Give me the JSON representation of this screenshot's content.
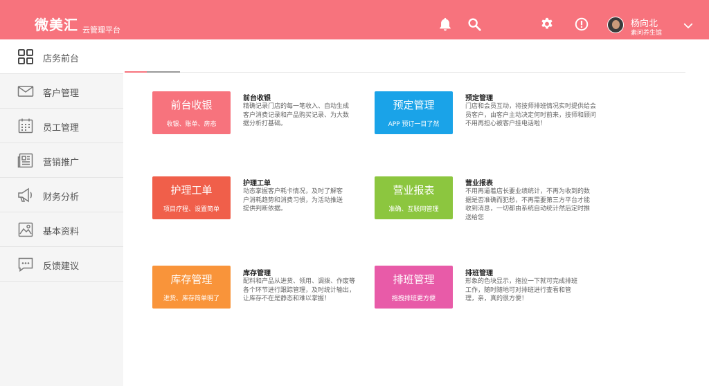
{
  "header": {
    "logo": "微美汇",
    "logo_sub": "云管理平台",
    "user_name": "杨向北",
    "user_store": "素问养生馆",
    "bg_color": "#f7737d",
    "icons": [
      "bell-icon",
      "search-icon",
      "gear-icon",
      "alert-icon",
      "chevron-down-icon"
    ]
  },
  "sidebar": {
    "top": {
      "label": "店务前台",
      "icon": "grid-icon"
    },
    "items": [
      {
        "label": "客户管理",
        "icon": "mail-icon"
      },
      {
        "label": "员工管理",
        "icon": "calendar-icon"
      },
      {
        "label": "营销推广",
        "icon": "newspaper-icon"
      },
      {
        "label": "财务分析",
        "icon": "megaphone-icon"
      },
      {
        "label": "基本资料",
        "icon": "image-icon"
      },
      {
        "label": "反馈建议",
        "icon": "chat-icon"
      }
    ]
  },
  "modules": [
    {
      "title": "前台收银",
      "sub": "收银、账单、房态",
      "color": "#f7737d",
      "desc_title": "前台收银",
      "desc": "精确记录门店的每一笔收入、自动生成客户消费记录和产品购买记录、为大数据分析打基础。"
    },
    {
      "title": "预定管理",
      "sub": "APP 预订一目了然",
      "color": "#1aa3e8",
      "desc_title": "预定管理",
      "desc": "门店和会员互动，将技师排班情况实时提供给会员客户，由客户主动决定何时前来，技师和顾问不用再担心被客户挂电话啦！"
    },
    {
      "title": "护理工单",
      "sub": "项目疗程、设置简单",
      "color": "#f05f4a",
      "desc_title": "护理工单",
      "desc": "动态掌握客户耗卡情况，及时了解客户消耗趋势和消费习惯，为活动推送提供判断依据。"
    },
    {
      "title": "营业报表",
      "sub": "准确、互联网管理",
      "color": "#8cc63f",
      "desc_title": "营业报表",
      "desc": "不用再逼着店长要业绩统计，不再为收到的数据是否准确而犯愁，不再需要第三方平台才能收到消息，一切都由系统自动统计然后定时推送给您"
    },
    {
      "title": "库存管理",
      "sub": "进货、库存简单明了",
      "color": "#f9943a",
      "desc_title": "库存管理",
      "desc": "配料和产品从进货、领用、调拨、作废等各个环节进行跟踪管理，及时统计输出，让库存不在是静态和难以掌握！"
    },
    {
      "title": "排班管理",
      "sub": "拖拽排班更方便",
      "color": "#e85ba8",
      "desc_title": "排班管理",
      "desc": "形象的色块显示，拖拉一下就可完成排班工作，随时随地可对排班进行查看和管理，亲，真的很方便！"
    }
  ]
}
